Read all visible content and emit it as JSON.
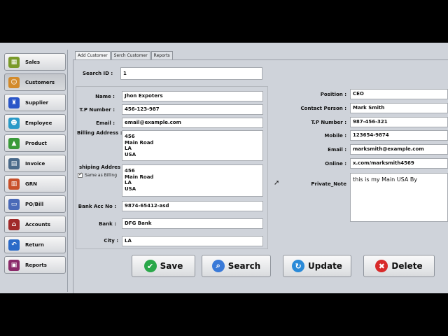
{
  "sidebar": {
    "items": [
      {
        "label": "Sales",
        "icon": "cash-register-icon",
        "color": "#7a9a2a",
        "active": false
      },
      {
        "label": "Customers",
        "icon": "customer-icon",
        "color": "#d38a2a",
        "active": true
      },
      {
        "label": "Supplier",
        "icon": "supplier-icon",
        "color": "#2a56c8",
        "active": false
      },
      {
        "label": "Employee",
        "icon": "employee-icon",
        "color": "#2a9ac8",
        "active": false
      },
      {
        "label": "Product",
        "icon": "product-icon",
        "color": "#3a9a3a",
        "active": false
      },
      {
        "label": "Invoice",
        "icon": "invoice-icon",
        "color": "#4a6a8a",
        "active": false
      },
      {
        "label": "GRN",
        "icon": "grn-icon",
        "color": "#c8502a",
        "active": false
      },
      {
        "label": "PO/Bill",
        "icon": "po-bill-icon",
        "color": "#4a6ab8",
        "active": false
      },
      {
        "label": "Accounts",
        "icon": "bank-icon",
        "color": "#a02a2a",
        "active": false
      },
      {
        "label": "Return",
        "icon": "return-icon",
        "color": "#2a6ac8",
        "active": false
      },
      {
        "label": "Reports",
        "icon": "reports-icon",
        "color": "#8a2a6a",
        "active": false
      }
    ]
  },
  "tabs": [
    {
      "label": "Add Customer",
      "active": true
    },
    {
      "label": "Serch Customer",
      "active": false
    },
    {
      "label": "Reports",
      "active": false
    }
  ],
  "search": {
    "label": "Search ID :",
    "value": "1"
  },
  "left_form": {
    "name": {
      "label": "Name :",
      "value": "Jhon Expoters"
    },
    "tp": {
      "label": "T.P Number :",
      "value": "456-123-987"
    },
    "email": {
      "label": "Email :",
      "value": "email@example.com"
    },
    "billing": {
      "label": "Billing Address :",
      "lines": [
        "456",
        "Main Road",
        "LA",
        "USA"
      ]
    },
    "shipping": {
      "label": "shiping Addres :",
      "lines": [
        "456",
        "Main Road",
        "LA",
        "USA"
      ]
    },
    "same_as_billing": {
      "label": "Same as Billing",
      "checked": true
    },
    "bank_acc": {
      "label": "Bank Acc No :",
      "value": "9874-65412-asd"
    },
    "bank": {
      "label": "Bank :",
      "value": "DFG Bank"
    },
    "city": {
      "label": "City :",
      "value": "LA"
    }
  },
  "right_form": {
    "position": {
      "label": "Position :",
      "value": "CEO"
    },
    "contact": {
      "label": "Contact Person :",
      "value": "Mark Smith"
    },
    "tp": {
      "label": "T.P Number :",
      "value": "987-456-321"
    },
    "mobile": {
      "label": "Mobile :",
      "value": "123654-9874"
    },
    "email": {
      "label": "Email :",
      "value": "marksmith@example.com"
    },
    "online": {
      "label": "Online :",
      "value": "x.com/marksmith4569"
    },
    "note": {
      "label": "Private_Note",
      "value": "this is my Main USA By"
    }
  },
  "actions": [
    {
      "label": "Save",
      "icon": "check-icon",
      "color": "#2aa84a",
      "glyph": "✔"
    },
    {
      "label": "Search",
      "icon": "magnifier-icon",
      "color": "#3a7ad8",
      "glyph": "⌕"
    },
    {
      "label": "Update",
      "icon": "refresh-icon",
      "color": "#2a8ad8",
      "glyph": "↻"
    },
    {
      "label": "Delete",
      "icon": "delete-icon",
      "color": "#d82a2a",
      "glyph": "✖"
    }
  ]
}
